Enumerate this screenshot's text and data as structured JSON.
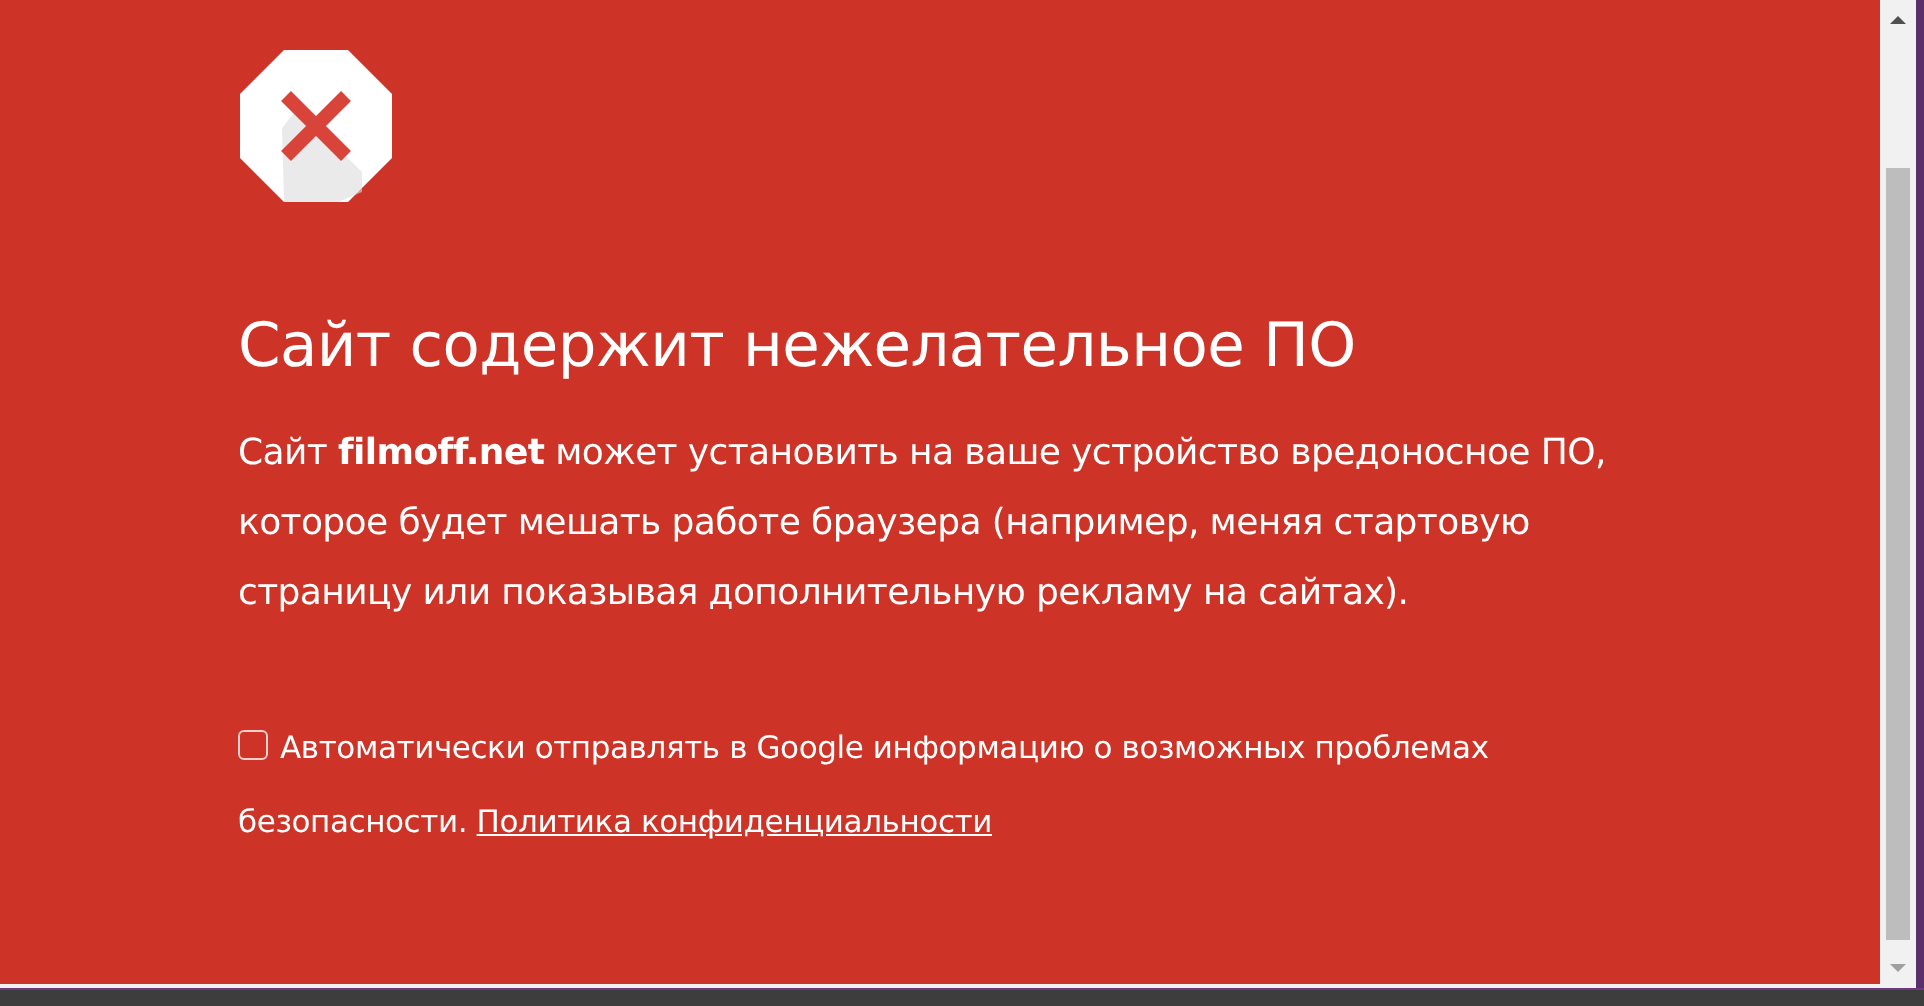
{
  "warning": {
    "title": "Сайт содержит нежелательное ПО",
    "description": "Сайт **filmoff.net** может установить на ваше устройство вредоносное ПО, которое будет мешать работе браузера (например, меняя стартовую страницу или показывая дополнительную рекламу на сайтах).",
    "report_option": {
      "checked": false,
      "label": "Автоматически отправлять в Google информацию о возможных проблемах безопасности.",
      "link": "Политика конфиденциальности"
    }
  }
}
